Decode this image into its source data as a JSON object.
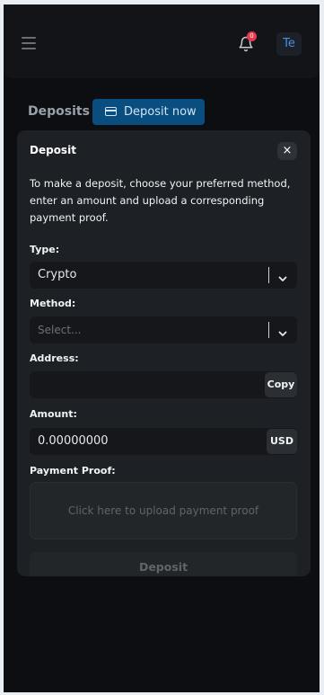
{
  "header": {
    "notification_count": "0",
    "avatar_initials": "Te"
  },
  "page": {
    "title": "Deposits",
    "deposit_now_label": "Deposit now"
  },
  "modal": {
    "title": "Deposit",
    "close_label": "×",
    "instructions": "To make a deposit, choose your preferred method, enter an amount and upload a corresponding payment proof.",
    "type_label": "Type:",
    "type_value": "Crypto",
    "method_label": "Method:",
    "method_placeholder": "Select...",
    "address_label": "Address:",
    "address_value": "",
    "copy_label": "Copy",
    "amount_label": "Amount:",
    "amount_value": "0.00000000",
    "currency_label": "USD",
    "proof_label": "Payment Proof:",
    "upload_text": "Click here to upload payment proof",
    "submit_label": "Deposit"
  },
  "colors": {
    "accent": "#0a4e80",
    "badge": "#e53950",
    "avatar_text": "#4a90e2"
  },
  "icons": [
    "hamburger-menu-icon",
    "bell-icon",
    "credit-card-icon",
    "close-icon",
    "chevron-down-icon"
  ]
}
